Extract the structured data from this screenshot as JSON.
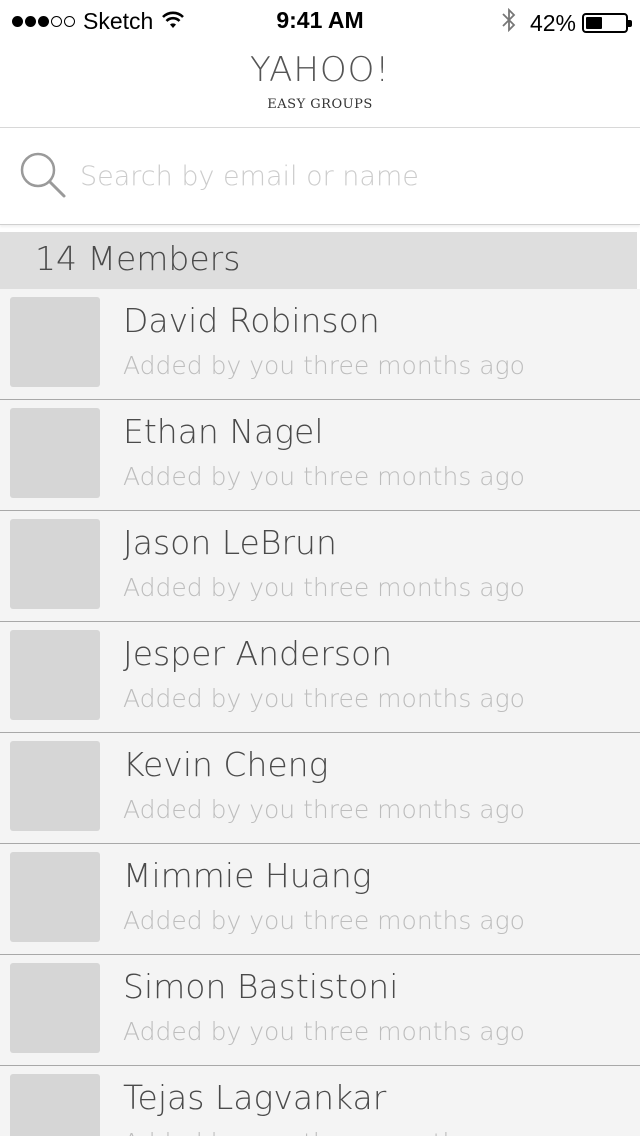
{
  "status_bar": {
    "carrier": "Sketch",
    "time": "9:41 AM",
    "battery_text": "42%",
    "battery_level": 0.42,
    "signal_bars_filled": 3,
    "signal_bars_total": 5
  },
  "header": {
    "title": "YAHOO!",
    "subtitle": "EASY GROUPS"
  },
  "search": {
    "placeholder": "Search by email or name",
    "value": ""
  },
  "members_section": {
    "title": "14 Members"
  },
  "members": [
    {
      "name": "David Robinson",
      "meta": "Added by you three months ago"
    },
    {
      "name": "Ethan Nagel",
      "meta": "Added by you three months ago"
    },
    {
      "name": "Jason LeBrun",
      "meta": "Added by you three months ago"
    },
    {
      "name": "Jesper Anderson",
      "meta": "Added by you three months ago"
    },
    {
      "name": "Kevin Cheng",
      "meta": "Added by you three months ago"
    },
    {
      "name": "Mimmie Huang",
      "meta": "Added by you three months ago"
    },
    {
      "name": "Simon Bastistoni",
      "meta": "Added by you three months ago"
    },
    {
      "name": "Tejas Lagvankar",
      "meta": "Added by you three months ago"
    }
  ],
  "colors": {
    "list_background": "#f4f4f4",
    "section_background": "#dedede",
    "avatar_placeholder": "#d6d6d6",
    "primary_text": "#4a4a4a",
    "secondary_text": "#bdbdbd"
  }
}
